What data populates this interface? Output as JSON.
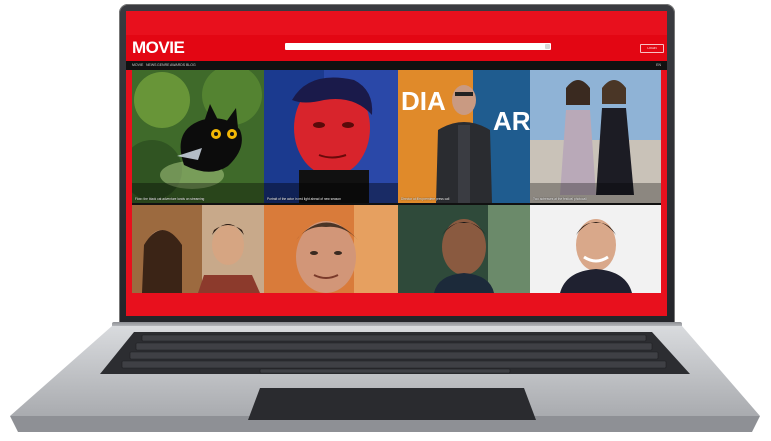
{
  "site": {
    "logo": "MOVIE",
    "search": {
      "placeholder": "",
      "value": ""
    },
    "login_label": "LOGIN",
    "nav": [
      "MOVIE",
      "NEWS",
      "GENRE",
      "AWARDS",
      "BLOG"
    ],
    "nav_right": "EN"
  },
  "articles": [
    {
      "caption": "Flow: the black cat adventure lands on streaming",
      "icon": "photo-black-cat"
    },
    {
      "caption": "Portrait of the actor in red light ahead of new season",
      "icon": "photo-red-portrait"
    },
    {
      "caption": "Director at film premiere press call",
      "icon": "photo-director"
    },
    {
      "caption": "Two actresses at the festival photocall",
      "icon": "photo-actresses"
    },
    {
      "caption": "",
      "icon": "photo-film-still"
    },
    {
      "caption": "",
      "icon": "photo-actor-1"
    },
    {
      "caption": "",
      "icon": "photo-actor-2"
    },
    {
      "caption": "",
      "icon": "photo-actor-3"
    }
  ],
  "colors": {
    "brand_red": "#e30613",
    "nav_dark": "#111111",
    "laptop_bezel": "#2a2b30",
    "laptop_body": "#bfc1c5"
  }
}
